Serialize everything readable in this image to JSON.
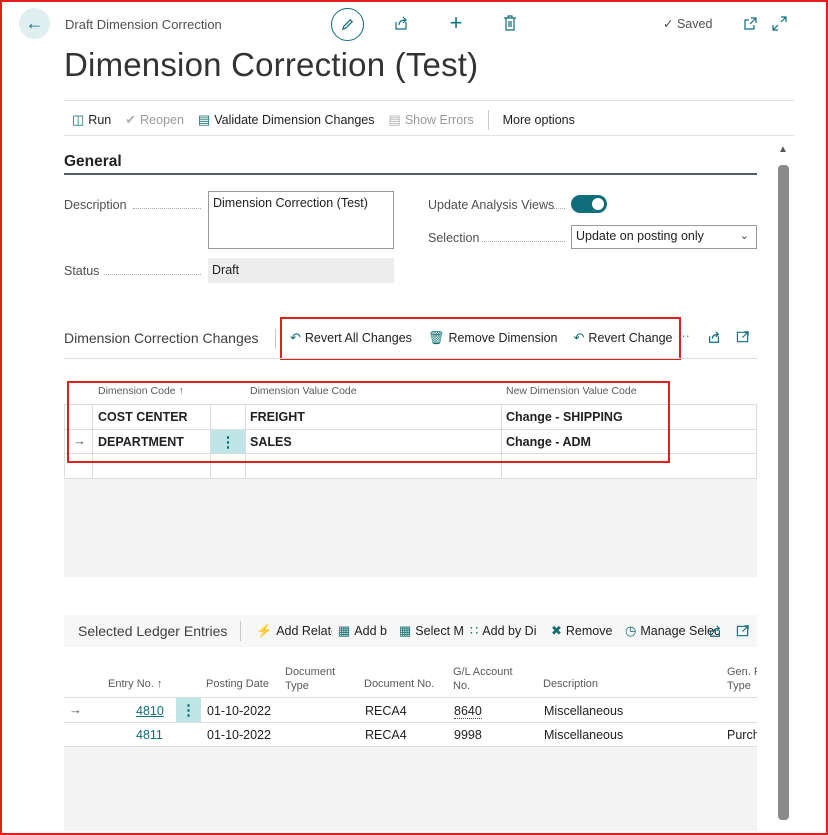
{
  "topbar": {
    "breadcrumb": "Draft Dimension Correction",
    "saved_label": "Saved"
  },
  "page": {
    "title": "Dimension Correction (Test)"
  },
  "actions": {
    "run": "Run",
    "reopen": "Reopen",
    "validate": "Validate Dimension Changes",
    "show_errors": "Show Errors",
    "more": "More options"
  },
  "general": {
    "header": "General",
    "description_label": "Description",
    "description_value": "Dimension Correction (Test)",
    "status_label": "Status",
    "status_value": "Draft",
    "update_views_label": "Update Analysis Views",
    "update_views_on": true,
    "selection_label": "Selection",
    "selection_value": "Update on posting only"
  },
  "changes": {
    "header": "Dimension Correction Changes",
    "actions": {
      "revert_all": "Revert All Changes",
      "remove_dimension": "Remove Dimension",
      "revert_change": "Revert Change"
    },
    "columns": [
      "Dimension Code ↑",
      "Dimension Value Code",
      "New Dimension Value Code"
    ],
    "rows": [
      {
        "code": "COST CENTER",
        "value": "FREIGHT",
        "new_value": "Change - SHIPPING"
      },
      {
        "code": "DEPARTMENT",
        "value": "SALES",
        "new_value": "Change - ADM"
      }
    ]
  },
  "ledger": {
    "header": "Selected Ledger Entries",
    "actions": {
      "add_related": "Add Relate",
      "add_by": "Add b",
      "select_m": "Select M",
      "add_by_di": "Add by Di",
      "remove": "Remove",
      "manage": "Manage Selec"
    },
    "columns": {
      "entry_no": "Entry No. ↑",
      "posting_date": "Posting Date",
      "doc_type_1": "Document",
      "doc_type_2": "Type",
      "doc_no": "Document No.",
      "gl_1": "G/L Account",
      "gl_2": "No.",
      "description": "Description",
      "gen_1": "Gen. P",
      "gen_2": "Type"
    },
    "rows": [
      {
        "entry_no": "4810",
        "posting_date": "01-10-2022",
        "doc_type": "",
        "doc_no": "RECA4",
        "gl": "8640",
        "description": "Miscellaneous",
        "gen": ""
      },
      {
        "entry_no": "4811",
        "posting_date": "01-10-2022",
        "doc_type": "",
        "doc_no": "RECA4",
        "gl": "9998",
        "description": "Miscellaneous",
        "gen": "Purch"
      }
    ]
  },
  "colors": {
    "accent": "#0f6e7a",
    "highlight": "#e0201b"
  },
  "icons": [
    "back-arrow-icon",
    "edit-icon",
    "share-icon",
    "add-icon",
    "delete-icon",
    "checkmark-icon",
    "popout-icon",
    "expand-icon"
  ]
}
